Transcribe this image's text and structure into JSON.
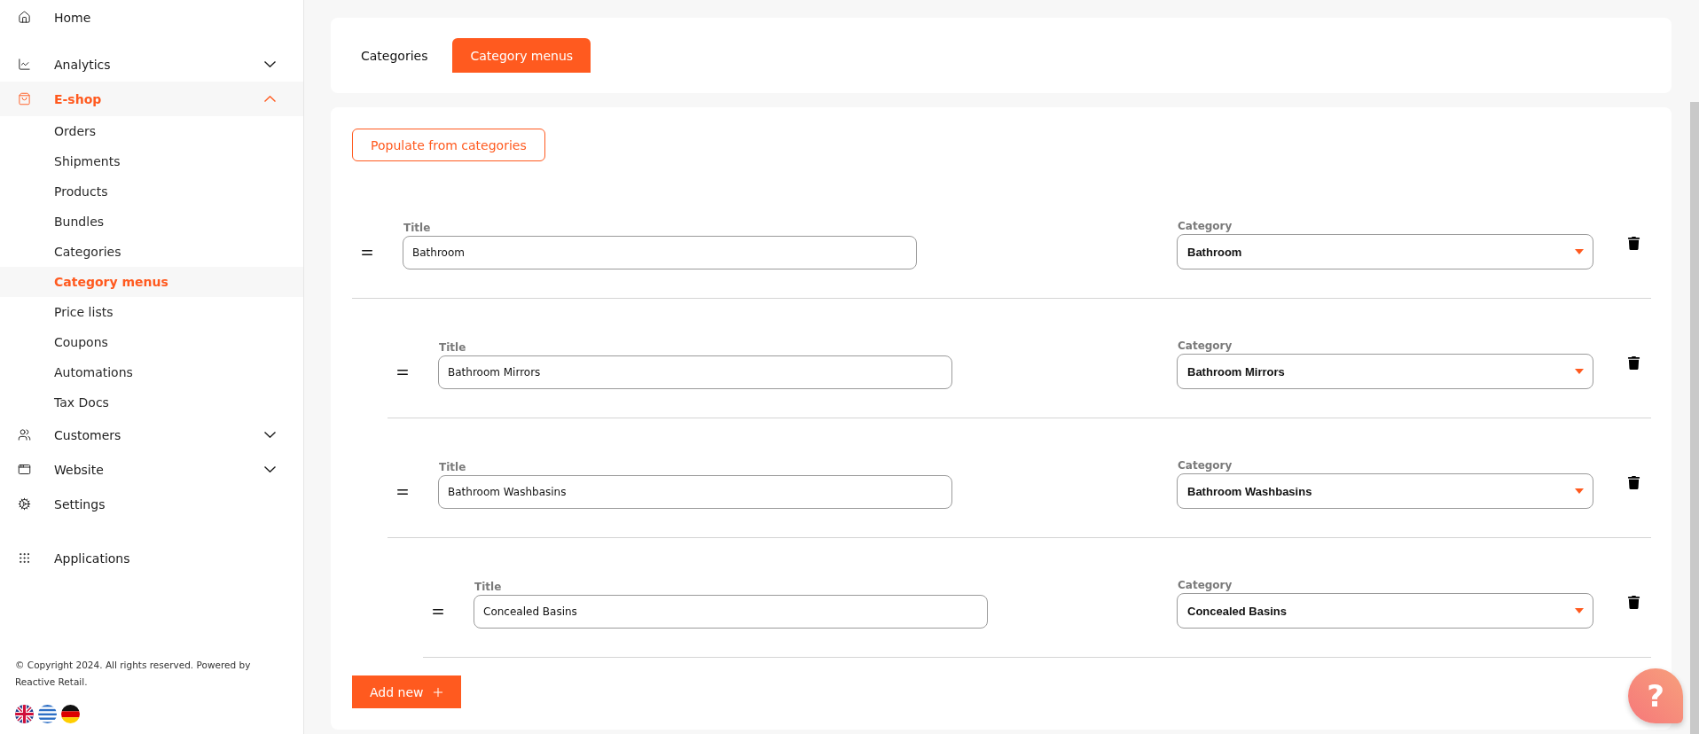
{
  "sidebar": {
    "sections": [
      {
        "items": [
          {
            "label": "Home",
            "selected": false
          }
        ]
      },
      {
        "items": [
          {
            "label": "Analytics",
            "selected": false,
            "expanded": false
          },
          {
            "label": "E-shop",
            "selected": true,
            "expanded": true,
            "children": [
              {
                "label": "Orders",
                "selected": false
              },
              {
                "label": "Shipments",
                "selected": false
              },
              {
                "label": "Products",
                "selected": false
              },
              {
                "label": "Bundles",
                "selected": false
              },
              {
                "label": "Categories",
                "selected": false
              },
              {
                "label": "Category menus",
                "selected": true
              },
              {
                "label": "Price lists",
                "selected": false
              },
              {
                "label": "Coupons",
                "selected": false
              },
              {
                "label": "Automations",
                "selected": false
              },
              {
                "label": "Tax Docs",
                "selected": false
              }
            ]
          },
          {
            "label": "Customers",
            "selected": false,
            "expanded": false
          },
          {
            "label": "Website",
            "selected": false,
            "expanded": false
          },
          {
            "label": "Settings",
            "selected": false
          }
        ]
      },
      {
        "items": [
          {
            "label": "Applications",
            "selected": false
          }
        ]
      }
    ],
    "copyright": "© Copyright 2024. All rights reserved. Powered by Reactive Retail."
  },
  "tabs": [
    {
      "label": "Categories",
      "selected": false
    },
    {
      "label": "Category menus",
      "selected": true
    }
  ],
  "populate_button": "Populate from categories",
  "menu_items": [
    {
      "title_label": "Title",
      "title": "Bathroom",
      "category_label": "Category",
      "category": "Bathroom",
      "children": [
        {
          "title_label": "Title",
          "title": "Bathroom Mirrors",
          "category_label": "Category",
          "category": "Bathroom Mirrors"
        },
        {
          "title_label": "Title",
          "title": "Bathroom Washbasins",
          "category_label": "Category",
          "category": "Bathroom Washbasins",
          "children": [
            {
              "title_label": "Title",
              "title": "Concealed Basins",
              "category_label": "Category",
              "category": "Concealed Basins"
            }
          ]
        }
      ]
    }
  ],
  "add_button": "Add new",
  "help_button": "?"
}
